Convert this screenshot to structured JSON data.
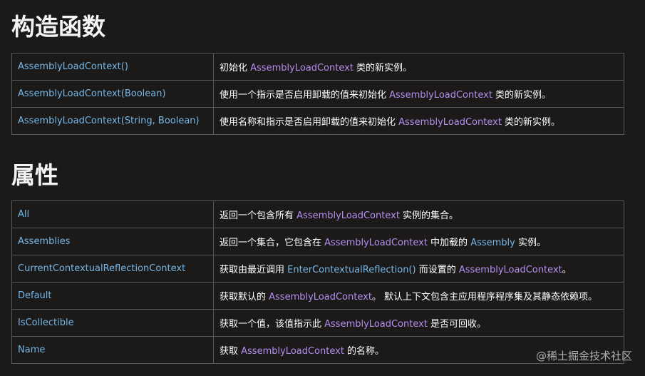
{
  "constructors": {
    "heading": "构造函数",
    "rows": [
      {
        "name": "AssemblyLoadContext()",
        "d1": "初始化 ",
        "link1": "AssemblyLoadContext",
        "d2": " 类的新实例。"
      },
      {
        "name": "AssemblyLoadContext(Boolean)",
        "d1": "使用一个指示是否启用卸载的值来初始化 ",
        "link1": "AssemblyLoadContext",
        "d2": " 类的新实例。"
      },
      {
        "name": "AssemblyLoadContext(String, Boolean)",
        "d1": "使用名称和指示是否启用卸载的值来初始化 ",
        "link1": "AssemblyLoadContext",
        "d2": " 类的新实例。"
      }
    ]
  },
  "properties": {
    "heading": "属性",
    "rows": [
      {
        "name": "All",
        "d1": "返回一个包含所有 ",
        "link1": "AssemblyLoadContext",
        "d2": " 实例的集合。"
      },
      {
        "name": "Assemblies",
        "d1": "返回一个集合，它包含在 ",
        "link1": "AssemblyLoadContext",
        "d2": " 中加载的 ",
        "link2": "Assembly",
        "d3": " 实例。"
      },
      {
        "name": "CurrentContextualReflectionContext",
        "d1": "获取由最近调用 ",
        "link1": "EnterContextualReflection()",
        "d2": " 而设置的 ",
        "link2": "AssemblyLoadContext",
        "d3": "。"
      },
      {
        "name": "Default",
        "d1": "获取默认的 ",
        "link1": "AssemblyLoadContext",
        "d2": "。 默认上下文包含主应用程序程序集及其静态依赖项。"
      },
      {
        "name": "IsCollectible",
        "d1": "获取一个值，该值指示此 ",
        "link1": "AssemblyLoadContext",
        "d2": " 是否可回收。"
      },
      {
        "name": "Name",
        "d1": "获取 ",
        "link1": "AssemblyLoadContext",
        "d2": " 的名称。"
      }
    ]
  },
  "watermark": "@稀土掘金技术社区"
}
